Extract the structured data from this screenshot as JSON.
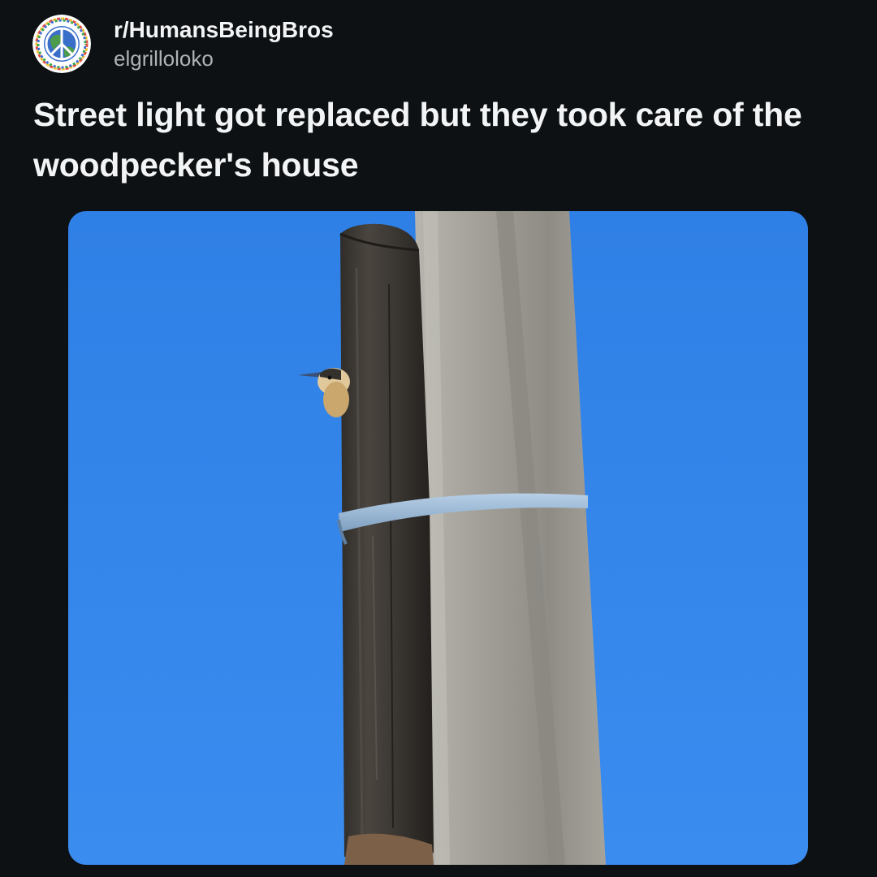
{
  "post": {
    "subreddit": "r/HumansBeingBros",
    "username": "elgrilloloko",
    "title": "Street light got replaced but they took care of the woodpecker's house",
    "avatar_icon": "peace-globe-icon",
    "image_subject": "woodpecker"
  },
  "colors": {
    "background": "#0e1113",
    "text_primary": "#f2f4f5",
    "text_secondary": "#aeb3b6",
    "sky": "#2f86e8"
  }
}
